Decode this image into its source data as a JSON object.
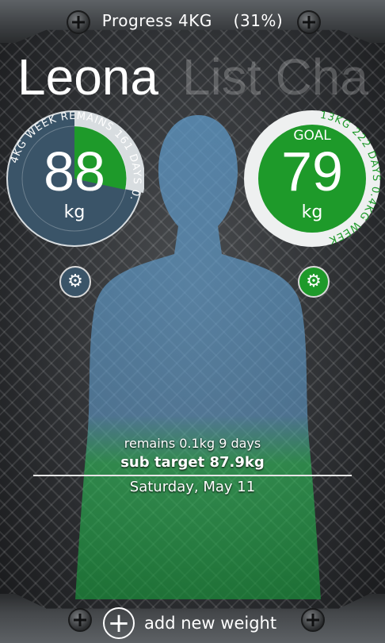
{
  "header": {
    "progress_label": "Progress 4KG",
    "progress_percent": "(31%)",
    "progress_fraction": 0.31
  },
  "pivot": {
    "active": "Leona",
    "next": "List",
    "next2": "Cha"
  },
  "current_gauge": {
    "value": "88",
    "unit": "kg",
    "ring_text": "4KG WEEK  REMAINS  161 DAYS 0.",
    "fill_fraction": 0.31
  },
  "goal_gauge": {
    "label": "GOAL",
    "value": "79",
    "unit": "kg",
    "ring_text": "13KG  222 DAYS  0.4KG WEEK"
  },
  "info": {
    "remains": "remains 0.1kg 9 days",
    "sub_target": "sub target 87.9kg",
    "date": "Saturday, May 11"
  },
  "footer": {
    "add_label": "add new weight"
  },
  "colors": {
    "accent_green": "#1e9a2a",
    "gauge_blue": "#3a5468",
    "gauge_ring": "#d8dde0"
  },
  "icons": {
    "settings": "gear-icon",
    "add": "plus-circle-icon"
  }
}
